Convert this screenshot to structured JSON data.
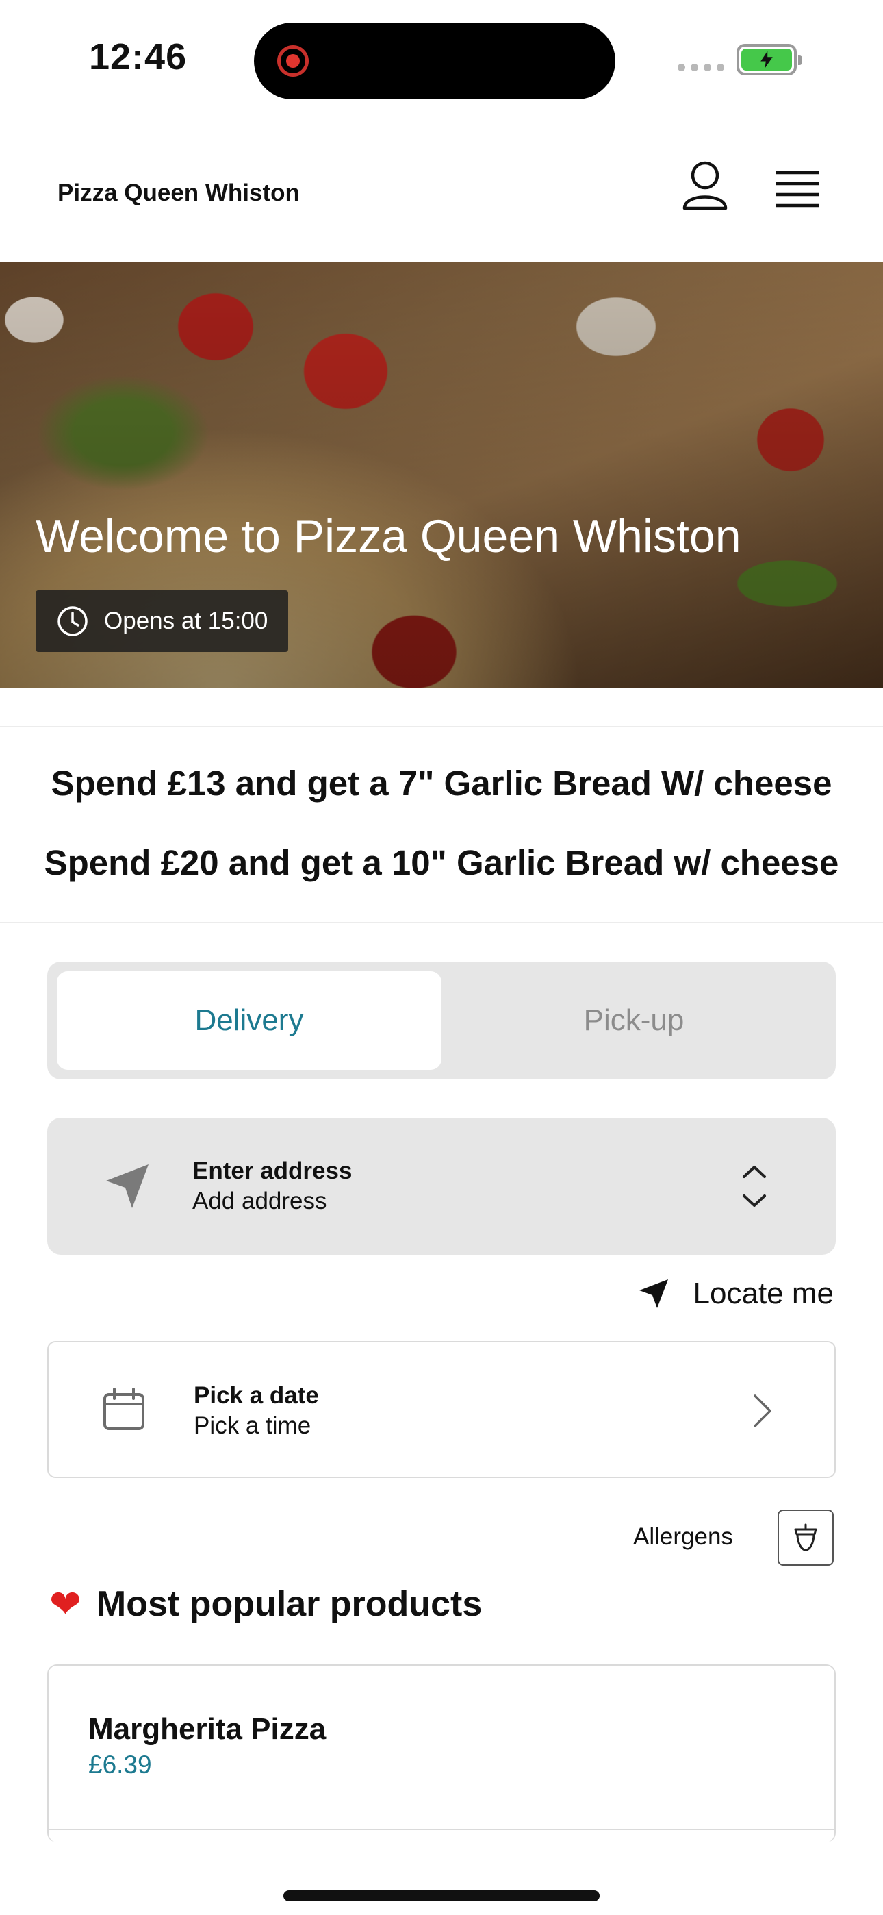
{
  "status_bar": {
    "time": "12:46"
  },
  "header": {
    "brand": "Pizza Queen Whiston"
  },
  "hero": {
    "title": "Welcome to Pizza Queen Whiston",
    "hours": "Opens at 15:00"
  },
  "promo": {
    "line1": "Spend £13 and get a 7\" Garlic Bread W/ cheese",
    "line2": "Spend £20 and get a 10\"  Garlic Bread w/ cheese"
  },
  "order_mode": {
    "options": [
      "Delivery",
      "Pick-up"
    ],
    "selected": "Delivery"
  },
  "address": {
    "label": "Enter address",
    "value": "Add address"
  },
  "locate": {
    "label": "Locate me"
  },
  "schedule": {
    "label": "Pick a date",
    "value": "Pick a time"
  },
  "allergens": {
    "label": "Allergens"
  },
  "popular": {
    "title": "Most popular products",
    "products": [
      {
        "name": "Margherita Pizza",
        "price": "£6.39"
      }
    ]
  },
  "colors": {
    "accent": "#1d7a90",
    "battery": "#45c84a",
    "heart": "#e02020"
  }
}
